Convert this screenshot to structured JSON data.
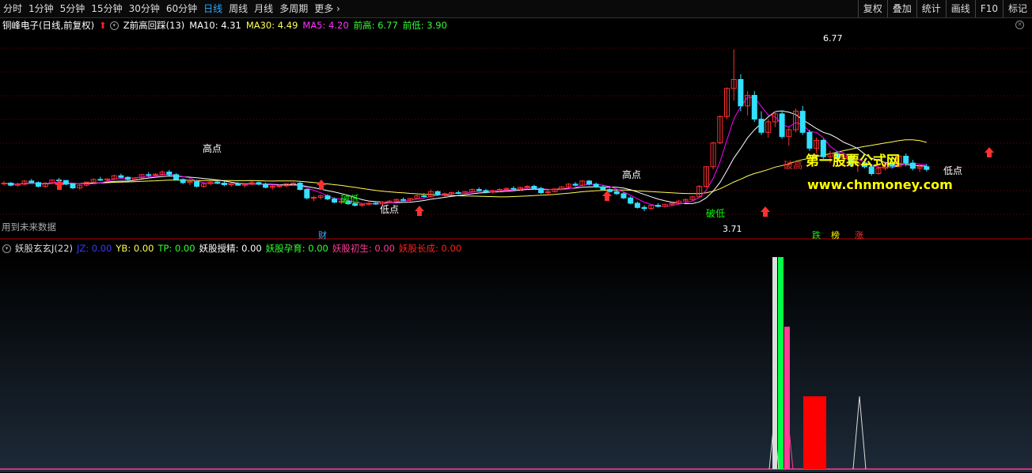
{
  "toolbar": {
    "tabs": [
      "分时",
      "1分钟",
      "5分钟",
      "15分钟",
      "30分钟",
      "60分钟",
      "日线",
      "周线",
      "月线",
      "多周期",
      "更多 ›"
    ],
    "active_index": 6,
    "right_buttons": [
      "复权",
      "叠加",
      "统计",
      "画线",
      "F10",
      "标记"
    ]
  },
  "info": {
    "stock": "铜峰电子(日线,前复权)",
    "indicator": "Z前高回踩(13)",
    "ma10": "MA10: 4.31",
    "ma30": "MA30: 4.49",
    "ma5": "MA5: 4.20",
    "prev_high": "前高: 6.77",
    "prev_low": "前低: 3.90"
  },
  "colors": {
    "up": "#ff3030",
    "down": "#32e0ff",
    "ma5": "#ff00ff",
    "ma10": "#ffffff",
    "ma30": "#ffff55",
    "grid": "#7a0000",
    "green": "#00ff00",
    "yellow": "#ffff00",
    "pink": "#ff3c96"
  },
  "annotations": {
    "high1": "高点",
    "high2": "高点",
    "low1": "低点",
    "low2": "低点",
    "break_low1": "破低",
    "break_low2": "破低",
    "break_high": "破高",
    "peak_value": "6.77",
    "low_value": "3.71",
    "future_data": "用到未来数据",
    "cai": "财",
    "die": "跌",
    "bang": "榜",
    "zhang": "涨"
  },
  "watermark": {
    "title": "第一股票公式网",
    "url": "www.chnmoney.com"
  },
  "panel2": {
    "name": "妖股玄玄J(22)",
    "jz": "JZ: 0.00",
    "yb": "YB: 0.00",
    "tp": "TP: 0.00",
    "ys_jing": "妖股授精: 0.00",
    "ys_yun": "妖股孕育: 0.00",
    "ys_chu": "妖股初生: 0.00",
    "ys_zhang": "妖股长成: 0.00"
  },
  "chart_data": {
    "type": "candlestick",
    "ylim": [
      3.5,
      7.0
    ],
    "candles": [
      [
        4.23,
        4.28,
        4.2,
        4.24
      ],
      [
        4.24,
        4.26,
        4.18,
        4.2
      ],
      [
        4.2,
        4.25,
        4.17,
        4.22
      ],
      [
        4.22,
        4.3,
        4.2,
        4.28
      ],
      [
        4.28,
        4.32,
        4.24,
        4.25
      ],
      [
        4.25,
        4.27,
        4.16,
        4.18
      ],
      [
        4.18,
        4.26,
        4.15,
        4.24
      ],
      [
        4.24,
        4.31,
        4.22,
        4.3
      ],
      [
        4.3,
        4.34,
        4.27,
        4.29
      ],
      [
        4.29,
        4.3,
        4.2,
        4.22
      ],
      [
        4.22,
        4.24,
        4.13,
        4.15
      ],
      [
        4.15,
        4.22,
        4.12,
        4.2
      ],
      [
        4.2,
        4.27,
        4.18,
        4.26
      ],
      [
        4.26,
        4.33,
        4.24,
        4.31
      ],
      [
        4.31,
        4.36,
        4.28,
        4.3
      ],
      [
        4.3,
        4.33,
        4.26,
        4.32
      ],
      [
        4.32,
        4.4,
        4.3,
        4.38
      ],
      [
        4.38,
        4.42,
        4.33,
        4.35
      ],
      [
        4.35,
        4.37,
        4.29,
        4.31
      ],
      [
        4.31,
        4.35,
        4.28,
        4.34
      ],
      [
        4.34,
        4.41,
        4.32,
        4.4
      ],
      [
        4.4,
        4.45,
        4.36,
        4.39
      ],
      [
        4.39,
        4.43,
        4.35,
        4.41
      ],
      [
        4.41,
        4.48,
        4.38,
        4.45
      ],
      [
        4.45,
        4.49,
        4.38,
        4.4
      ],
      [
        4.4,
        4.43,
        4.29,
        4.31
      ],
      [
        4.31,
        4.33,
        4.22,
        4.25
      ],
      [
        4.25,
        4.29,
        4.2,
        4.27
      ],
      [
        4.27,
        4.3,
        4.16,
        4.18
      ],
      [
        4.18,
        4.25,
        4.15,
        4.23
      ],
      [
        4.23,
        4.28,
        4.2,
        4.26
      ],
      [
        4.26,
        4.3,
        4.22,
        4.24
      ],
      [
        4.24,
        4.27,
        4.18,
        4.21
      ],
      [
        4.21,
        4.25,
        4.17,
        4.23
      ],
      [
        4.23,
        4.26,
        4.19,
        4.2
      ],
      [
        4.2,
        4.24,
        4.16,
        4.22
      ],
      [
        4.22,
        4.28,
        4.2,
        4.25
      ],
      [
        4.25,
        4.27,
        4.2,
        4.22
      ],
      [
        4.22,
        4.25,
        4.14,
        4.16
      ],
      [
        4.16,
        4.2,
        4.12,
        4.18
      ],
      [
        4.18,
        4.22,
        4.15,
        4.19
      ],
      [
        4.19,
        4.24,
        4.16,
        4.23
      ],
      [
        4.23,
        4.26,
        4.2,
        4.24
      ],
      [
        4.24,
        4.26,
        4.1,
        4.12
      ],
      [
        4.12,
        4.14,
        3.93,
        3.96
      ],
      [
        3.96,
        4.0,
        3.9,
        3.97
      ],
      [
        3.97,
        4.02,
        3.93,
        4.0
      ],
      [
        4.0,
        4.03,
        3.92,
        3.94
      ],
      [
        3.94,
        3.97,
        3.86,
        3.88
      ],
      [
        3.88,
        3.92,
        3.84,
        3.9
      ],
      [
        3.9,
        3.93,
        3.83,
        3.85
      ],
      [
        3.85,
        3.88,
        3.8,
        3.82
      ],
      [
        3.82,
        3.86,
        3.79,
        3.84
      ],
      [
        3.84,
        3.88,
        3.82,
        3.86
      ],
      [
        3.86,
        3.89,
        3.83,
        3.85
      ],
      [
        3.85,
        3.9,
        3.83,
        3.88
      ],
      [
        3.88,
        3.92,
        3.86,
        3.9
      ],
      [
        3.9,
        3.95,
        3.88,
        3.93
      ],
      [
        3.93,
        3.97,
        3.9,
        3.92
      ],
      [
        3.92,
        3.96,
        3.89,
        3.95
      ],
      [
        3.95,
        4.02,
        3.93,
        4.0
      ],
      [
        4.0,
        4.05,
        3.97,
        3.99
      ],
      [
        3.99,
        4.12,
        3.97,
        4.08
      ],
      [
        4.08,
        4.1,
        4.0,
        4.02
      ],
      [
        4.02,
        4.06,
        3.98,
        4.04
      ],
      [
        4.04,
        4.08,
        4.01,
        4.06
      ],
      [
        4.06,
        4.1,
        4.03,
        4.05
      ],
      [
        4.05,
        4.09,
        4.02,
        4.08
      ],
      [
        4.08,
        4.14,
        4.06,
        4.12
      ],
      [
        4.12,
        4.16,
        4.08,
        4.1
      ],
      [
        4.1,
        4.13,
        4.05,
        4.07
      ],
      [
        4.07,
        4.11,
        4.04,
        4.1
      ],
      [
        4.1,
        4.14,
        4.07,
        4.12
      ],
      [
        4.12,
        4.16,
        4.09,
        4.14
      ],
      [
        4.14,
        4.18,
        4.11,
        4.13
      ],
      [
        4.13,
        4.17,
        4.1,
        4.16
      ],
      [
        4.16,
        4.2,
        4.12,
        4.18
      ],
      [
        4.18,
        4.21,
        4.12,
        4.14
      ],
      [
        4.14,
        4.17,
        4.04,
        4.06
      ],
      [
        4.06,
        4.1,
        4.02,
        4.08
      ],
      [
        4.08,
        4.14,
        4.06,
        4.13
      ],
      [
        4.13,
        4.18,
        4.11,
        4.17
      ],
      [
        4.17,
        4.24,
        4.15,
        4.22
      ],
      [
        4.22,
        4.26,
        4.18,
        4.2
      ],
      [
        4.2,
        4.3,
        4.18,
        4.28
      ],
      [
        4.28,
        4.3,
        4.2,
        4.22
      ],
      [
        4.22,
        4.25,
        4.15,
        4.17
      ],
      [
        4.17,
        4.2,
        4.1,
        4.12
      ],
      [
        4.12,
        4.15,
        4.06,
        4.08
      ],
      [
        4.08,
        4.11,
        4.02,
        4.04
      ],
      [
        4.04,
        4.07,
        3.94,
        3.96
      ],
      [
        3.96,
        3.99,
        3.84,
        3.86
      ],
      [
        3.86,
        3.89,
        3.76,
        3.78
      ],
      [
        3.78,
        3.82,
        3.71,
        3.76
      ],
      [
        3.76,
        3.84,
        3.74,
        3.82
      ],
      [
        3.82,
        3.86,
        3.78,
        3.8
      ],
      [
        3.8,
        3.85,
        3.78,
        3.84
      ],
      [
        3.84,
        3.88,
        3.81,
        3.86
      ],
      [
        3.86,
        3.92,
        3.84,
        3.9
      ],
      [
        3.9,
        3.95,
        3.87,
        3.93
      ],
      [
        3.93,
        4.0,
        3.91,
        3.98
      ],
      [
        3.98,
        4.2,
        3.96,
        4.18
      ],
      [
        4.18,
        4.56,
        4.15,
        4.55
      ],
      [
        4.55,
        5.02,
        4.5,
        5.0
      ],
      [
        5.0,
        5.52,
        4.98,
        5.5
      ],
      [
        5.5,
        6.05,
        5.45,
        6.03
      ],
      [
        6.03,
        6.77,
        5.8,
        6.2
      ],
      [
        6.2,
        6.3,
        5.6,
        5.7
      ],
      [
        5.7,
        5.98,
        5.52,
        5.9
      ],
      [
        5.9,
        5.98,
        5.4,
        5.45
      ],
      [
        5.45,
        5.6,
        5.15,
        5.2
      ],
      [
        5.2,
        5.45,
        5.1,
        5.4
      ],
      [
        5.4,
        5.6,
        5.3,
        5.55
      ],
      [
        5.55,
        5.62,
        5.08,
        5.12
      ],
      [
        5.12,
        5.3,
        4.95,
        5.25
      ],
      [
        5.25,
        5.65,
        5.2,
        5.6
      ],
      [
        5.6,
        5.7,
        5.15,
        5.2
      ],
      [
        5.2,
        5.25,
        4.85,
        4.9
      ],
      [
        4.9,
        5.1,
        4.8,
        5.05
      ],
      [
        5.05,
        5.08,
        4.7,
        4.74
      ],
      [
        4.74,
        4.85,
        4.62,
        4.8
      ],
      [
        4.8,
        4.85,
        4.66,
        4.7
      ],
      [
        4.7,
        4.78,
        4.58,
        4.75
      ],
      [
        4.75,
        4.8,
        4.55,
        4.58
      ],
      [
        4.58,
        4.66,
        4.45,
        4.62
      ],
      [
        4.62,
        4.7,
        4.52,
        4.55
      ],
      [
        4.55,
        4.6,
        4.38,
        4.42
      ],
      [
        4.42,
        4.56,
        4.4,
        4.52
      ],
      [
        4.52,
        4.65,
        4.48,
        4.6
      ],
      [
        4.6,
        4.7,
        4.52,
        4.56
      ],
      [
        4.56,
        4.78,
        4.54,
        4.75
      ],
      [
        4.75,
        4.8,
        4.56,
        4.62
      ],
      [
        4.62,
        4.68,
        4.48,
        4.52
      ],
      [
        4.52,
        4.58,
        4.45,
        4.55
      ],
      [
        4.55,
        4.6,
        4.46,
        4.5
      ]
    ]
  }
}
